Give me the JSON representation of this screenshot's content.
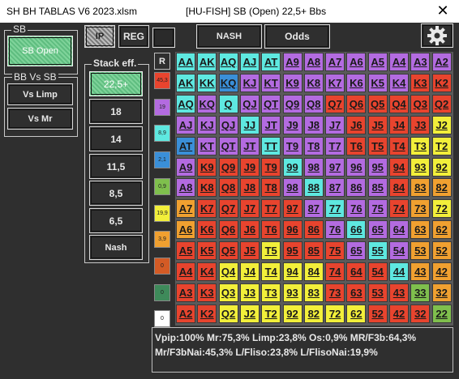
{
  "window": {
    "file_title": "SH BH TABLAS V6 2023.xlsm",
    "context_title": "[HU-FISH] SB (Open) 22,5+ Bbs",
    "close_symbol": "✕"
  },
  "sb_group": {
    "legend": "SB",
    "button_label": "SB Open"
  },
  "top_buttons": {
    "ip_label": "IP",
    "reg_label": "REG",
    "nash_label": "NASH",
    "odds_label": "Odds"
  },
  "bb_vs_sb": {
    "legend": "BB Vs SB",
    "limp_label": "Vs Limp",
    "mr_label": "Vs Mr"
  },
  "stack": {
    "legend": "Stack eff.",
    "options": [
      "22,5+",
      "18",
      "14",
      "11,5",
      "8,5",
      "6,5",
      "Nash"
    ],
    "selected": "22,5+"
  },
  "swatches": {
    "header": "R",
    "items": [
      {
        "label": "45,3",
        "color": "#e8442e"
      },
      {
        "label": "19",
        "color": "#b36be0"
      },
      {
        "label": "8,9",
        "color": "#5ee8e0"
      },
      {
        "label": "2,1",
        "color": "#3a8fd8"
      },
      {
        "label": "0,9",
        "color": "#7fbf4d"
      },
      {
        "label": "19,9",
        "color": "#f2ef3a"
      },
      {
        "label": "3,9",
        "color": "#f0a030"
      },
      {
        "label": "0",
        "color": "#d45b25"
      },
      {
        "label": "0",
        "color": "#3e8a5a"
      },
      {
        "label": "0",
        "color": "#ffffff"
      }
    ]
  },
  "colors": {
    "R": "#e8442e",
    "P": "#b36be0",
    "C": "#5ee8e0",
    "B": "#3a8fd8",
    "G": "#7fbf4d",
    "Y": "#f2ef3a",
    "O": "#f0a030"
  },
  "grid": {
    "labels": [
      [
        "AA",
        "AK",
        "AQ",
        "AJ",
        "AT",
        "A9",
        "A8",
        "A7",
        "A6",
        "A5",
        "A4",
        "A3",
        "A2"
      ],
      [
        "AK",
        "KK",
        "KQ",
        "KJ",
        "KT",
        "K9",
        "K8",
        "K7",
        "K6",
        "K5",
        "K4",
        "K3",
        "K2"
      ],
      [
        "AQ",
        "KQ",
        "Q",
        "QJ",
        "QT",
        "Q9",
        "Q8",
        "Q7",
        "Q6",
        "Q5",
        "Q4",
        "Q3",
        "Q2"
      ],
      [
        "AJ",
        "KJ",
        "QJ",
        "JJ",
        "JT",
        "J9",
        "J8",
        "J7",
        "J6",
        "J5",
        "J4",
        "J3",
        "J2"
      ],
      [
        "AT",
        "KT",
        "QT",
        "JT",
        "TT",
        "T9",
        "T8",
        "T7",
        "T6",
        "T5",
        "T4",
        "T3",
        "T2"
      ],
      [
        "A9",
        "K9",
        "Q9",
        "J9",
        "T9",
        "99",
        "98",
        "97",
        "96",
        "95",
        "94",
        "93",
        "92"
      ],
      [
        "A8",
        "K8",
        "Q8",
        "J8",
        "T8",
        "98",
        "88",
        "87",
        "86",
        "85",
        "84",
        "83",
        "82"
      ],
      [
        "A7",
        "K7",
        "Q7",
        "J7",
        "T7",
        "97",
        "87",
        "77",
        "76",
        "75",
        "74",
        "73",
        "72"
      ],
      [
        "A6",
        "K6",
        "Q6",
        "J6",
        "T6",
        "96",
        "86",
        "76",
        "66",
        "65",
        "64",
        "63",
        "62"
      ],
      [
        "A5",
        "K5",
        "Q5",
        "J5",
        "T5",
        "95",
        "85",
        "75",
        "65",
        "55",
        "54",
        "53",
        "52"
      ],
      [
        "A4",
        "K4",
        "Q4",
        "J4",
        "T4",
        "94",
        "84",
        "74",
        "64",
        "54",
        "44",
        "43",
        "42"
      ],
      [
        "A3",
        "K3",
        "Q3",
        "J3",
        "T3",
        "93",
        "83",
        "73",
        "63",
        "53",
        "43",
        "33",
        "32"
      ],
      [
        "A2",
        "K2",
        "Q2",
        "J2",
        "T2",
        "92",
        "82",
        "72",
        "62",
        "52",
        "42",
        "32",
        "22"
      ]
    ],
    "colors": [
      [
        "C",
        "C",
        "C",
        "C",
        "C",
        "P",
        "P",
        "P",
        "P",
        "P",
        "P",
        "P",
        "P"
      ],
      [
        "C",
        "C",
        "B",
        "P",
        "P",
        "P",
        "P",
        "P",
        "P",
        "P",
        "P",
        "R",
        "R"
      ],
      [
        "C",
        "P",
        "C",
        "P",
        "P",
        "P",
        "P",
        "R",
        "R",
        "R",
        "R",
        "R",
        "R"
      ],
      [
        "P",
        "P",
        "P",
        "C",
        "P",
        "P",
        "P",
        "P",
        "R",
        "R",
        "R",
        "R",
        "Y"
      ],
      [
        "B",
        "P",
        "P",
        "P",
        "C",
        "P",
        "P",
        "P",
        "R",
        "R",
        "R",
        "Y",
        "Y"
      ],
      [
        "P",
        "R",
        "R",
        "R",
        "R",
        "C",
        "P",
        "P",
        "P",
        "P",
        "R",
        "Y",
        "Y"
      ],
      [
        "P",
        "R",
        "R",
        "R",
        "R",
        "P",
        "C",
        "P",
        "P",
        "P",
        "R",
        "O",
        "O"
      ],
      [
        "O",
        "R",
        "R",
        "R",
        "R",
        "R",
        "P",
        "C",
        "P",
        "P",
        "R",
        "O",
        "Y"
      ],
      [
        "O",
        "R",
        "R",
        "R",
        "R",
        "R",
        "R",
        "P",
        "C",
        "P",
        "P",
        "O",
        "O"
      ],
      [
        "R",
        "R",
        "R",
        "R",
        "Y",
        "R",
        "R",
        "R",
        "P",
        "C",
        "P",
        "O",
        "O"
      ],
      [
        "R",
        "R",
        "Y",
        "Y",
        "Y",
        "Y",
        "Y",
        "R",
        "R",
        "R",
        "C",
        "O",
        "O"
      ],
      [
        "R",
        "R",
        "Y",
        "Y",
        "Y",
        "Y",
        "Y",
        "R",
        "R",
        "R",
        "R",
        "G",
        "O"
      ],
      [
        "R",
        "R",
        "Y",
        "Y",
        "Y",
        "Y",
        "Y",
        "Y",
        "Y",
        "R",
        "R",
        "R",
        "G"
      ]
    ]
  },
  "stats": {
    "line1": "Vpip:100% Mr:75,3% Limp:23,8% Os:0,9% MR/F3b:64,3%",
    "line2": "Mr/F3bNai:45,3% L/Fliso:23,8% L/FlisoNai:19,9%"
  }
}
